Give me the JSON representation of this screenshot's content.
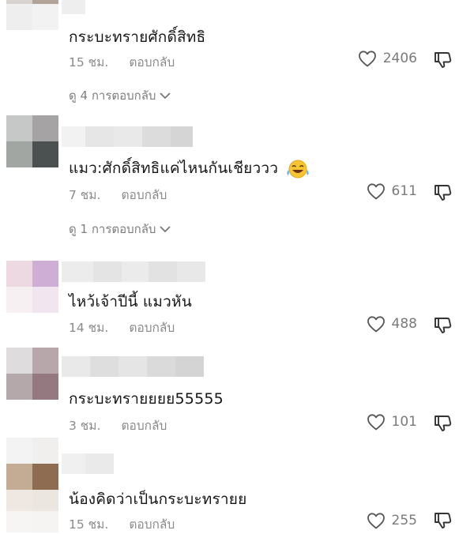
{
  "comments": [
    {
      "text": "กระบะทรายศักดิ์สิทธิ",
      "time": "15 ชม.",
      "reply": "ตอบกลับ",
      "likes": "2406",
      "view_replies": "ดู 4 การตอบกลับ"
    },
    {
      "text": "แมว:ศักดิ์สิทธิแค่ไหนกันเชียววว",
      "emoji": "face-with-tears-of-joy",
      "time": "7 ชม.",
      "reply": "ตอบกลับ",
      "likes": "611",
      "view_replies": "ดู 1 การตอบกลับ"
    },
    {
      "text": "ไหว้เจ้าปีนี้ แมวหัน",
      "time": "14 ชม.",
      "reply": "ตอบกลับ",
      "likes": "488"
    },
    {
      "text": "กระบะทรายยยย55555",
      "time": "3 ชม.",
      "reply": "ตอบกลับ",
      "likes": "101"
    },
    {
      "text": "น้องคิดว่าเป็นกระบะทรายย",
      "time": "15 ชม.",
      "reply": "ตอบกลับ",
      "likes": "255"
    }
  ],
  "icons": {
    "like": "heart-outline-icon",
    "dislike": "thumbs-down-outline-icon",
    "expand": "chevron-down-icon"
  }
}
